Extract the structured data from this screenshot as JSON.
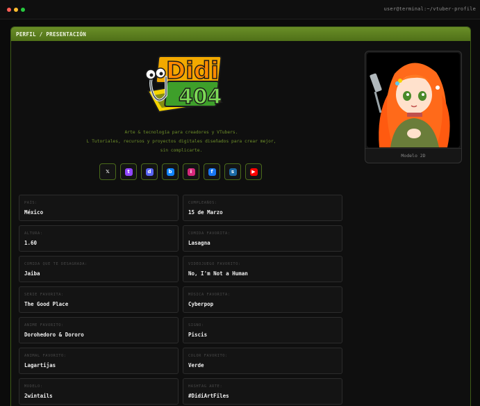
{
  "window": {
    "title": "user@terminal:~/vtuber-profile"
  },
  "panel": {
    "title": "PERFIL / PRESENTACIÓN"
  },
  "logo": {
    "text_top": "Didi",
    "text_bottom": "404"
  },
  "tagline": {
    "line1": "Arte & tecnología para creadores y VTubers.",
    "line2": "L Tutoriales, recursos y proyectos digitales diseñados para crear mejor,",
    "line3": "sin complicarte."
  },
  "socials": [
    {
      "icon": "x-icon",
      "glyph": "𝕏",
      "color": "#141414"
    },
    {
      "icon": "twitch-icon",
      "glyph": "t",
      "color": "#9146ff"
    },
    {
      "icon": "discord-icon",
      "glyph": "d",
      "color": "#5865f2"
    },
    {
      "icon": "bluesky-icon",
      "glyph": "b",
      "color": "#1185fe"
    },
    {
      "icon": "instagram-icon",
      "glyph": "i",
      "color": "#d6297b"
    },
    {
      "icon": "facebook-icon",
      "glyph": "f",
      "color": "#1877f2"
    },
    {
      "icon": "steam-icon",
      "glyph": "s",
      "color": "#1b6aa5"
    },
    {
      "icon": "youtube-icon",
      "glyph": "▶",
      "color": "#ff0000"
    }
  ],
  "avatar": {
    "caption": "Modelo 2D"
  },
  "info": [
    {
      "label": "PAÍS:",
      "value": "México"
    },
    {
      "label": "CUMPLEAÑOS:",
      "value": "15 de Marzo"
    },
    {
      "label": "ALTURA:",
      "value": "1.60"
    },
    {
      "label": "COMIDA FAVORITA:",
      "value": "Lasagna"
    },
    {
      "label": "COMIDA QUE TE DESAGRADA:",
      "value": "Jaiba"
    },
    {
      "label": "VIDEOJUEGO FAVORITO:",
      "value": "No, I'm Not a Human"
    },
    {
      "label": "SERIE FAVORITA:",
      "value": "The Good Place"
    },
    {
      "label": "MÚSICA FAVORITA:",
      "value": "Cyberpop"
    },
    {
      "label": "ANIME FAVORITO:",
      "value": "Dorohedoro & Dororo"
    },
    {
      "label": "SIGNO:",
      "value": "Piscis"
    },
    {
      "label": "ANIMAL FAVORITO:",
      "value": "Lagartijas"
    },
    {
      "label": "COLOR FAVORITO:",
      "value": "Verde"
    },
    {
      "label": "MODELO:",
      "value": "2wintails"
    },
    {
      "label": "HASHTAG ARTE:",
      "value": "#DidiArtFiles"
    }
  ],
  "colors": {
    "accent": "#5a7e1f",
    "tagline": "#6e8f2a"
  }
}
